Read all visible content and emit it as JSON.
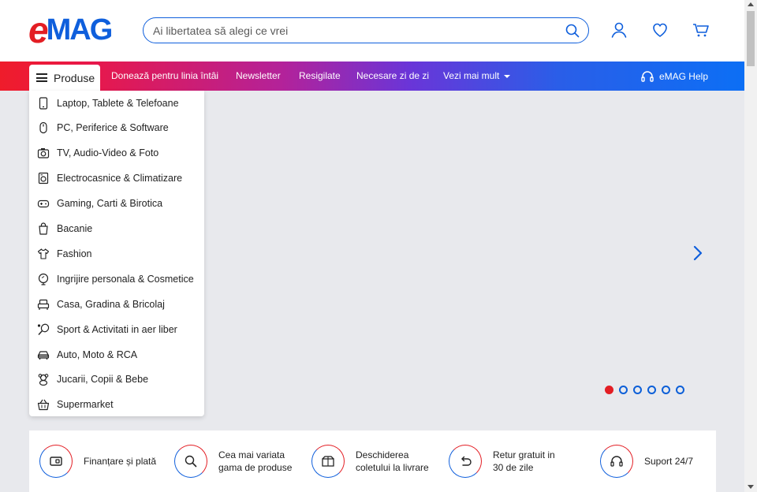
{
  "logo": {
    "e": "e",
    "mag": "MAG"
  },
  "search": {
    "placeholder": "Ai libertatea să alegi ce vrei"
  },
  "nav": {
    "products_label": "Produse",
    "links": [
      "Donează pentru linia întâi",
      "Newsletter",
      "Resigilate",
      "Necesare zi de zi",
      "Vezi mai mult"
    ],
    "help_label": "eMAG Help"
  },
  "menu": {
    "items": [
      {
        "label": "Laptop, Tablete & Telefoane",
        "icon": "phone-icon"
      },
      {
        "label": "PC, Periferice & Software",
        "icon": "mouse-icon"
      },
      {
        "label": "TV, Audio-Video & Foto",
        "icon": "camera-icon"
      },
      {
        "label": "Electrocasnice & Climatizare",
        "icon": "washing-machine-icon"
      },
      {
        "label": "Gaming, Carti & Birotica",
        "icon": "gamepad-icon"
      },
      {
        "label": "Bacanie",
        "icon": "shopping-bag-icon"
      },
      {
        "label": "Fashion",
        "icon": "tshirt-icon"
      },
      {
        "label": "Ingrijire personala & Cosmetice",
        "icon": "mirror-icon"
      },
      {
        "label": "Casa, Gradina & Bricolaj",
        "icon": "armchair-icon"
      },
      {
        "label": "Sport & Activitati in aer liber",
        "icon": "racket-icon"
      },
      {
        "label": "Auto, Moto & RCA",
        "icon": "car-icon"
      },
      {
        "label": "Jucarii, Copii & Bebe",
        "icon": "teddy-bear-icon"
      },
      {
        "label": "Supermarket",
        "icon": "basket-icon"
      }
    ]
  },
  "carousel": {
    "slide_count": 6,
    "active_index": 0
  },
  "features": [
    {
      "label": "Finanțare și plată",
      "icon": "card-icon"
    },
    {
      "label": "Cea mai variata\ngama de produse",
      "icon": "search-icon"
    },
    {
      "label": "Deschiderea\ncoletului la livrare",
      "icon": "box-icon"
    },
    {
      "label": "Retur gratuit in\n30 de zile",
      "icon": "return-icon"
    },
    {
      "label": "Suport 24/7",
      "icon": "headset-icon"
    }
  ],
  "colors": {
    "red": "#e31e24",
    "blue": "#0f5fdc"
  }
}
